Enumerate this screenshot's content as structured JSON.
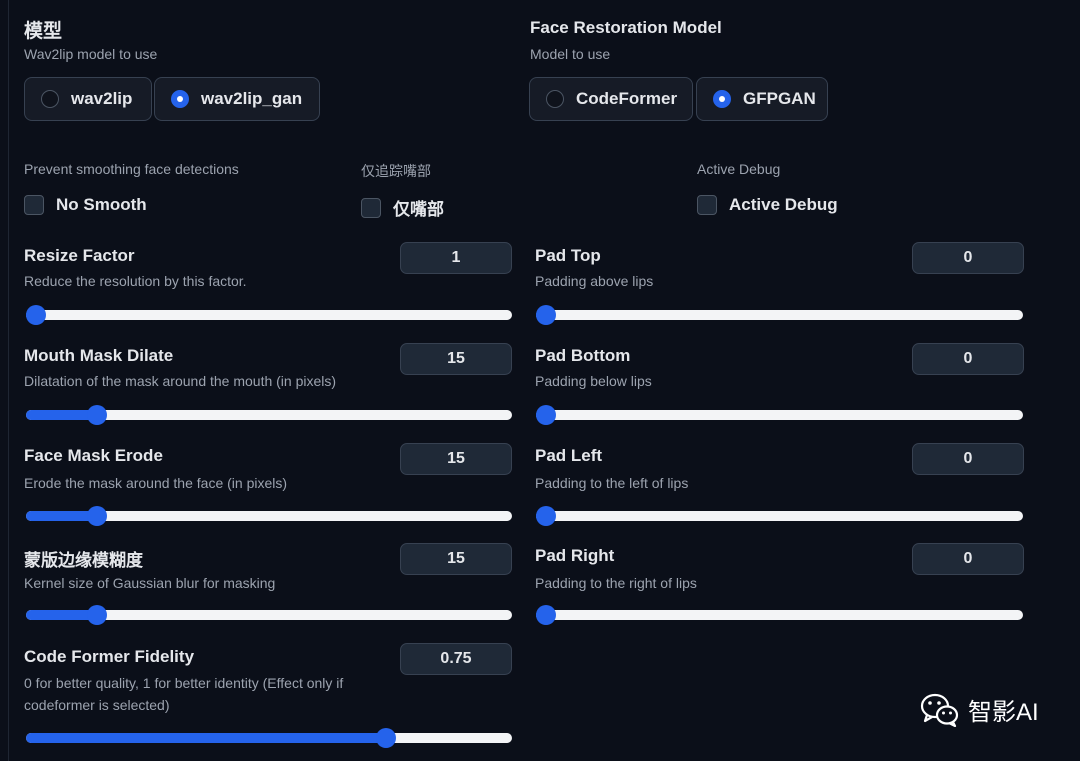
{
  "model": {
    "title": "模型",
    "subtitle": "Wav2lip model to use",
    "options": [
      "wav2lip",
      "wav2lip_gan"
    ],
    "selected": "wav2lip_gan"
  },
  "face_restoration": {
    "title": "Face Restoration Model",
    "subtitle": "Model to use",
    "options": [
      "CodeFormer",
      "GFPGAN"
    ],
    "selected": "GFPGAN"
  },
  "checkboxes": [
    {
      "header": "Prevent smoothing face detections",
      "label": "No Smooth",
      "checked": false
    },
    {
      "header": "仅追踪嘴部",
      "label": "仅嘴部",
      "checked": false
    },
    {
      "header": "Active Debug",
      "label": "Active Debug",
      "checked": false
    }
  ],
  "sliders_left": [
    {
      "title": "Resize Factor",
      "desc": "Reduce the resolution by this factor.",
      "value": "1",
      "fraction": 0.0
    },
    {
      "title": "Mouth Mask Dilate",
      "desc": "Dilatation of the mask around the mouth (in pixels)",
      "value": "15",
      "fraction": 0.13
    },
    {
      "title": "Face Mask Erode",
      "desc": "Erode the mask around the face (in pixels)",
      "value": "15",
      "fraction": 0.13
    },
    {
      "title": "蒙版边缘模糊度",
      "desc": "Kernel size of Gaussian blur for masking",
      "value": "15",
      "fraction": 0.13
    },
    {
      "title": "Code Former Fidelity",
      "desc_line1": "0 for better quality, 1 for better identity (Effect only if",
      "desc_line2": "codeformer is selected)",
      "value": "0.75",
      "fraction": 0.75
    }
  ],
  "sliders_right": [
    {
      "title": "Pad Top",
      "desc": "Padding above lips",
      "value": "0",
      "fraction": 0.0
    },
    {
      "title": "Pad Bottom",
      "desc": "Padding below lips",
      "value": "0",
      "fraction": 0.0
    },
    {
      "title": "Pad Left",
      "desc": "Padding to the left of lips",
      "value": "0",
      "fraction": 0.0
    },
    {
      "title": "Pad Right",
      "desc": "Padding to the right of lips",
      "value": "0",
      "fraction": 0.0
    }
  ],
  "watermark": {
    "text": "智影AI",
    "icon": "wechat-icon"
  }
}
